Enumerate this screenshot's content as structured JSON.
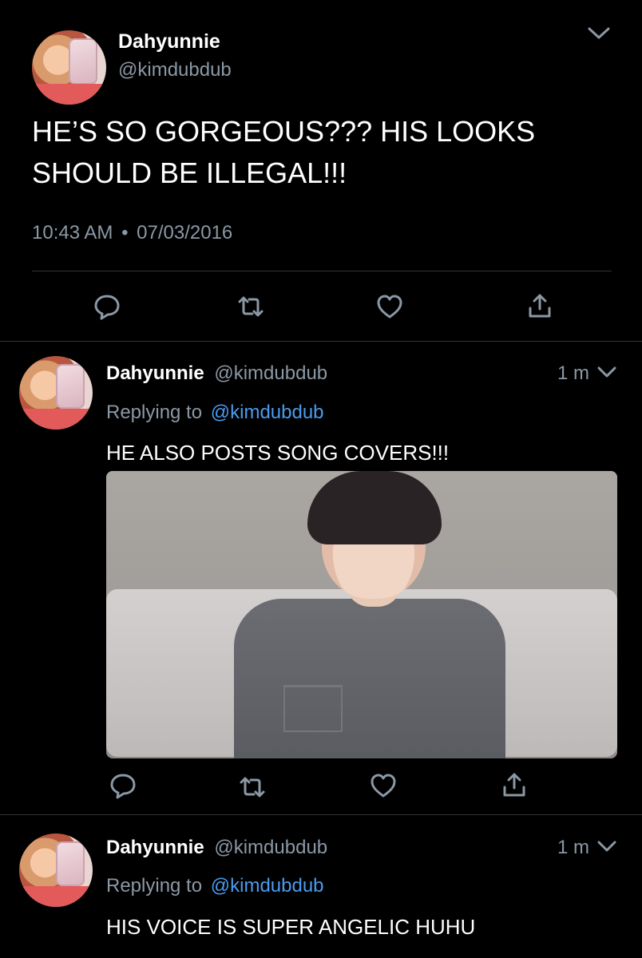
{
  "main_tweet": {
    "author_name": "Dahyunnie",
    "handle": "@kimdubdub",
    "text_line1": "HE’S SO GORGEOUS??? HIS LOOKS",
    "text_line2": "SHOULD BE ILLEGAL!!!",
    "time": "10:43 AM",
    "separator": "•",
    "date": "07/03/2016",
    "actions": [
      "reply-icon",
      "retweet-icon",
      "like-icon",
      "share-icon"
    ]
  },
  "replies": [
    {
      "author_name": "Dahyunnie",
      "handle": "@kimdubdub",
      "age": "1 m",
      "replying_prefix": "Replying to",
      "replying_handle": "@kimdubdub",
      "text": "HE ALSO POSTS SONG COVERS!!!",
      "has_media": true
    },
    {
      "author_name": "Dahyunnie",
      "handle": "@kimdubdub",
      "age": "1 m",
      "replying_prefix": "Replying to",
      "replying_handle": "@kimdubdub",
      "text": "HIS VOICE IS SUPER ANGELIC HUHU"
    }
  ],
  "colors": {
    "background": "#000000",
    "muted": "#8b98a5",
    "link": "#4a9bf0",
    "divider": "#2f3336"
  }
}
